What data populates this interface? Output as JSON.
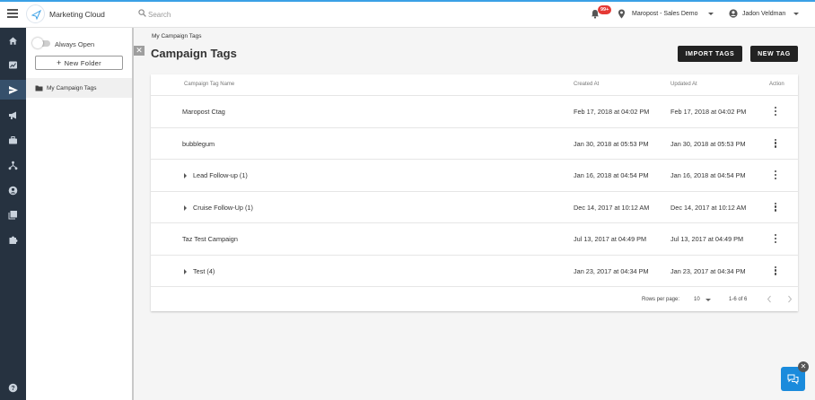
{
  "header": {
    "app_title": "Marketing Cloud",
    "search_placeholder": "Search",
    "notification_count": "99+",
    "account": "Maropost - Sales Demo",
    "user": "Jadon Veldman"
  },
  "rail": {
    "items": [
      {
        "name": "home-icon",
        "active": false
      },
      {
        "name": "dashboard-icon",
        "active": false
      },
      {
        "name": "send-icon",
        "active": true
      },
      {
        "name": "megaphone-icon",
        "active": false
      },
      {
        "name": "briefcase-icon",
        "active": false
      },
      {
        "name": "workflow-icon",
        "active": false
      },
      {
        "name": "contacts-icon",
        "active": false
      },
      {
        "name": "library-icon",
        "active": false
      },
      {
        "name": "puzzle-icon",
        "active": false
      }
    ],
    "help": "help-icon"
  },
  "folders": {
    "toggle_label": "Always Open",
    "new_folder_label": "New Folder",
    "items": [
      {
        "label": "My Campaign Tags",
        "selected": true
      }
    ]
  },
  "page": {
    "breadcrumb": "My Campaign Tags",
    "title": "Campaign Tags",
    "import_label": "IMPORT TAGS",
    "new_tag_label": "NEW TAG"
  },
  "table": {
    "headers": {
      "name": "Campaign Tag Name",
      "created": "Created At",
      "updated": "Updated At",
      "action": "Action"
    },
    "rows": [
      {
        "name": "Maropost Ctag",
        "created": "Feb 17, 2018 at 04:02 PM",
        "updated": "Feb 17, 2018 at 04:02 PM",
        "expandable": false
      },
      {
        "name": "bubblegum",
        "created": "Jan 30, 2018 at 05:53 PM",
        "updated": "Jan 30, 2018 at 05:53 PM",
        "expandable": false
      },
      {
        "name": "Lead Follow-up (1)",
        "created": "Jan 16, 2018 at 04:54 PM",
        "updated": "Jan 16, 2018 at 04:54 PM",
        "expandable": true
      },
      {
        "name": "Cruise Follow-Up (1)",
        "created": "Dec 14, 2017 at 10:12 AM",
        "updated": "Dec 14, 2017 at 10:12 AM",
        "expandable": true
      },
      {
        "name": "Taz Test Campaign",
        "created": "Jul 13, 2017 at 04:49 PM",
        "updated": "Jul 13, 2017 at 04:49 PM",
        "expandable": false
      },
      {
        "name": "Test (4)",
        "created": "Jan 23, 2017 at 04:34 PM",
        "updated": "Jan 23, 2017 at 04:34 PM",
        "expandable": true
      }
    ],
    "footer": {
      "rows_per_page_label": "Rows per page:",
      "rows_per_page": "10",
      "range": "1-6 of 6"
    }
  },
  "colors": {
    "accent": "#1a8bdc",
    "rail": "#263240",
    "button_dark": "#222222",
    "badge": "#e53935"
  }
}
